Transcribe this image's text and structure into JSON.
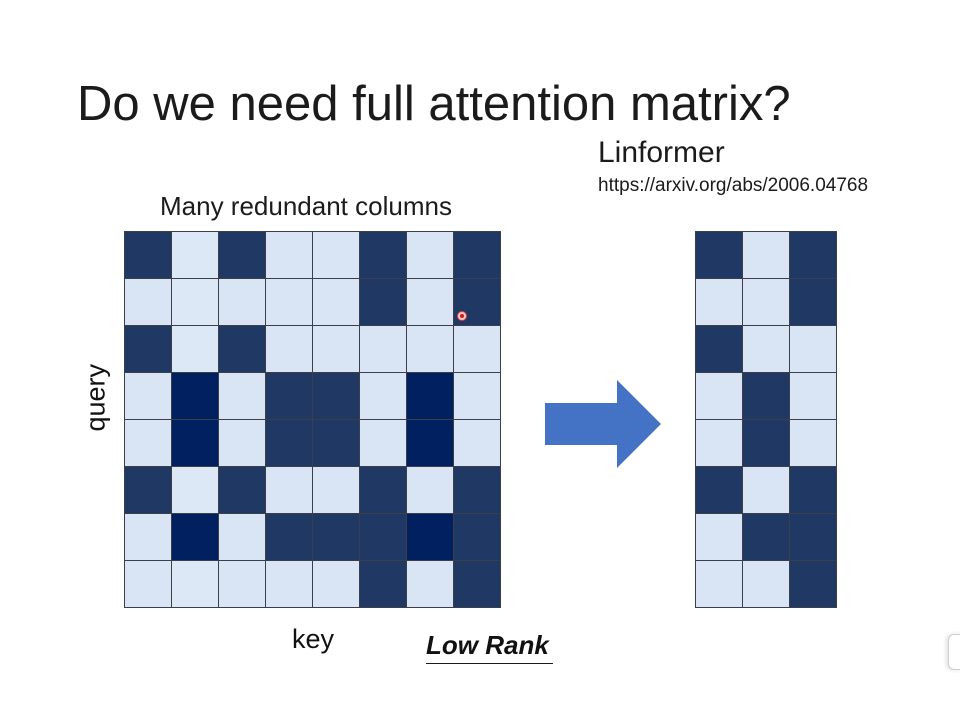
{
  "slide": {
    "title": "Do we need full attention matrix?",
    "reference_name": "Linformer",
    "reference_url": "https://arxiv.org/abs/2006.04768",
    "subtitle": "Many redundant columns",
    "y_label": "query",
    "x_label": "key",
    "low_rank_label": "Low Rank"
  },
  "colors": {
    "light": "#d9e4f4",
    "light2": "#dde8f6",
    "dark": "#203864",
    "darker": "#002060",
    "arrow": "#4472c4",
    "grid_line": "#3b3f4a"
  },
  "full_matrix": [
    [
      "dark",
      "light2",
      "dark",
      "light",
      "light",
      "dark",
      "light",
      "dark"
    ],
    [
      "light",
      "light2",
      "light",
      "light",
      "light",
      "dark",
      "light",
      "dark"
    ],
    [
      "dark",
      "light2",
      "dark",
      "light",
      "light",
      "light",
      "light",
      "light"
    ],
    [
      "light",
      "darker",
      "light",
      "dark",
      "dark",
      "light",
      "darker",
      "light"
    ],
    [
      "light",
      "darker",
      "light",
      "dark",
      "dark",
      "light",
      "darker",
      "light"
    ],
    [
      "dark",
      "light2",
      "dark",
      "light",
      "light",
      "dark",
      "light",
      "dark"
    ],
    [
      "light",
      "darker",
      "light",
      "dark",
      "dark",
      "dark",
      "darker",
      "dark"
    ],
    [
      "light",
      "light2",
      "light",
      "light",
      "light",
      "dark",
      "light",
      "dark"
    ]
  ],
  "low_rank_matrix": [
    [
      "dark",
      "light",
      "dark"
    ],
    [
      "light",
      "light",
      "dark"
    ],
    [
      "dark",
      "light",
      "light"
    ],
    [
      "light",
      "dark",
      "light"
    ],
    [
      "light",
      "dark",
      "light"
    ],
    [
      "dark",
      "light",
      "dark"
    ],
    [
      "light",
      "dark",
      "dark"
    ],
    [
      "light",
      "light",
      "dark"
    ]
  ]
}
